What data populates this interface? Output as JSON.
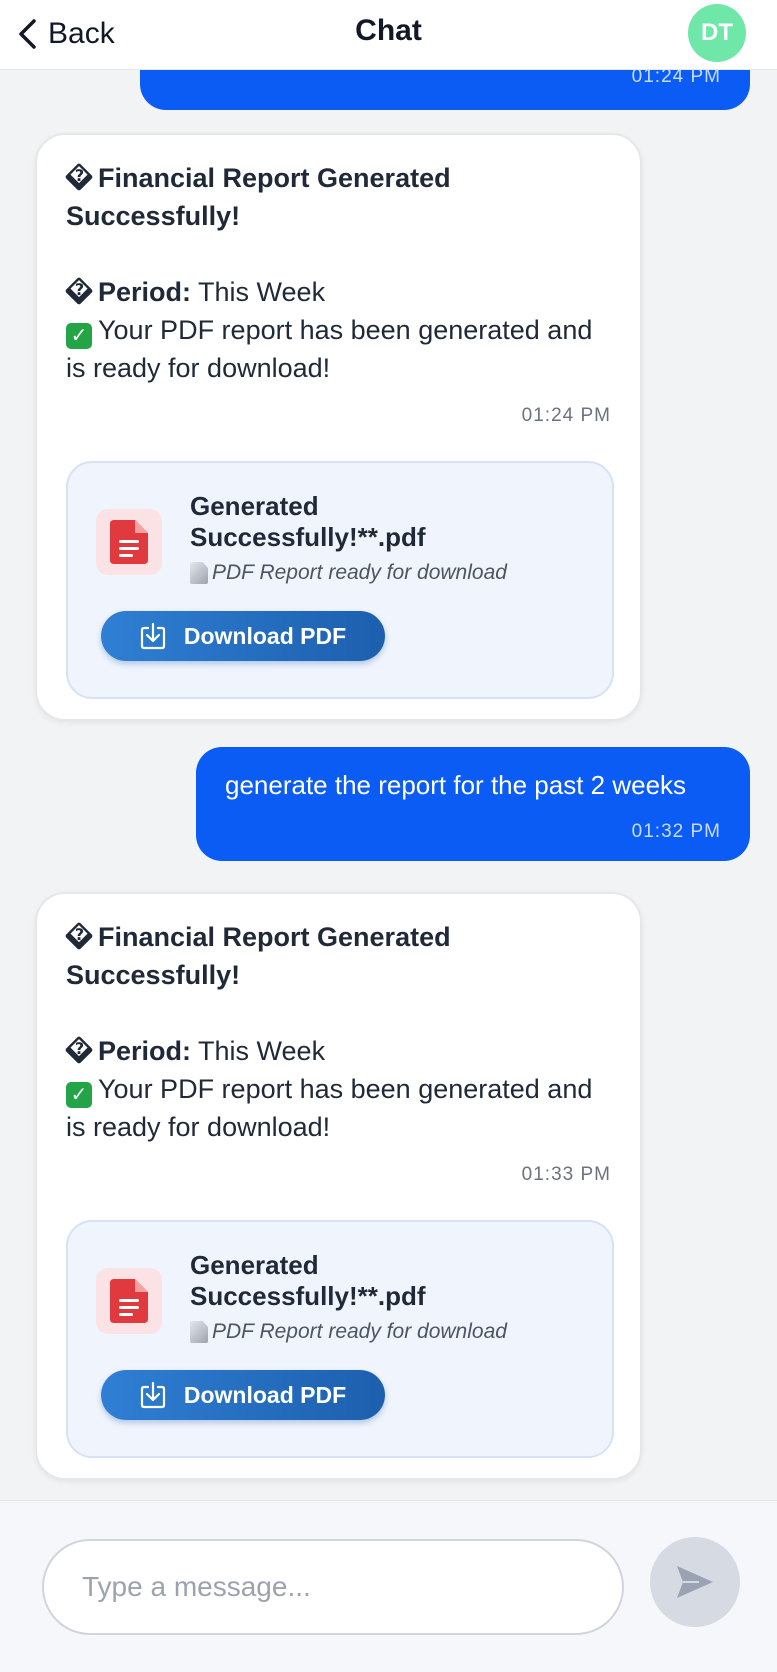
{
  "header": {
    "back_label": "Back",
    "title": "Chat",
    "avatar_initials": "DT",
    "avatar_color": "#6ee7a8"
  },
  "messages": [
    {
      "role": "user",
      "time": "01:24 PM"
    },
    {
      "role": "bot",
      "title_emoji": "�",
      "title": "Financial Report Generated Successfully!",
      "period_emoji": "�",
      "period_label": "Period:",
      "period_value": "This Week",
      "check_emoji": "✓",
      "status_text": "Your PDF report has been generated and is ready for download!",
      "time": "01:24 PM",
      "file_name": "Generated Successfully!**.pdf",
      "file_subtitle": "PDF Report ready for download",
      "download_label": "Download PDF"
    },
    {
      "role": "user",
      "text": "generate the report for the past 2 weeks",
      "time": "01:32 PM"
    },
    {
      "role": "bot",
      "title_emoji": "�",
      "title": "Financial Report Generated Successfully!",
      "period_emoji": "�",
      "period_label": "Period:",
      "period_value": "This Week",
      "check_emoji": "✓",
      "status_text": "Your PDF report has been generated and is ready for download!",
      "time": "01:33 PM",
      "file_name": "Generated Successfully!**.pdf",
      "file_subtitle": "PDF Report ready for download",
      "download_label": "Download PDF"
    }
  ],
  "composer": {
    "placeholder": "Type a message..."
  },
  "colors": {
    "user_bubble": "#0a5cf5",
    "download_button": "#2f7fd4",
    "pdf_icon": "#e03a3e"
  }
}
